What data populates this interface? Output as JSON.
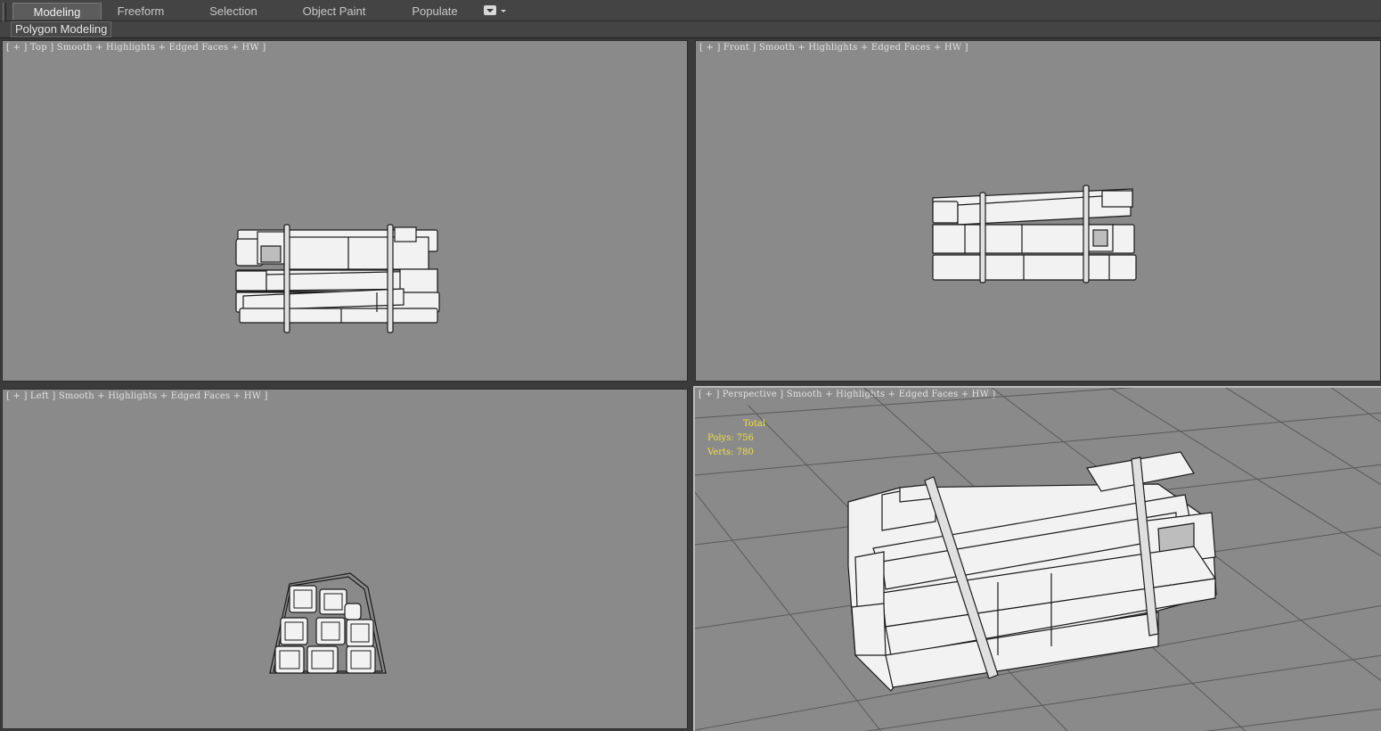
{
  "ribbon": {
    "tabs": [
      {
        "label": "Modeling",
        "active": true
      },
      {
        "label": "Freeform",
        "active": false
      },
      {
        "label": "Selection",
        "active": false
      },
      {
        "label": "Object Paint",
        "active": false
      },
      {
        "label": "Populate",
        "active": false
      }
    ],
    "menu_icon": "dropdown-box-icon",
    "panel_label": "Polygon Modeling"
  },
  "viewports": {
    "top": {
      "label": "[ + ] Top ] Smooth + Highlights + Edged Faces + HW ]"
    },
    "front": {
      "label": "[ + ] Front ] Smooth + Highlights + Edged Faces + HW ]"
    },
    "left": {
      "label": "[ + ] Left ] Smooth + Highlights + Edged Faces + HW ]"
    },
    "perspective": {
      "label": "[ + ] Perspective ] Smooth + Highlights + Edged Faces + HW ]",
      "stats": {
        "total_label": "Total",
        "polys_label": "Polys:",
        "polys": "756",
        "verts_label": "Verts:",
        "verts": "780"
      }
    }
  },
  "colors": {
    "viewport_bg": "#8a8a8a",
    "grid_line": "#5a5a5a",
    "stats_text": "#f0e040",
    "model_fill": "#f2f2f2",
    "model_edge": "#1a1a1a"
  }
}
